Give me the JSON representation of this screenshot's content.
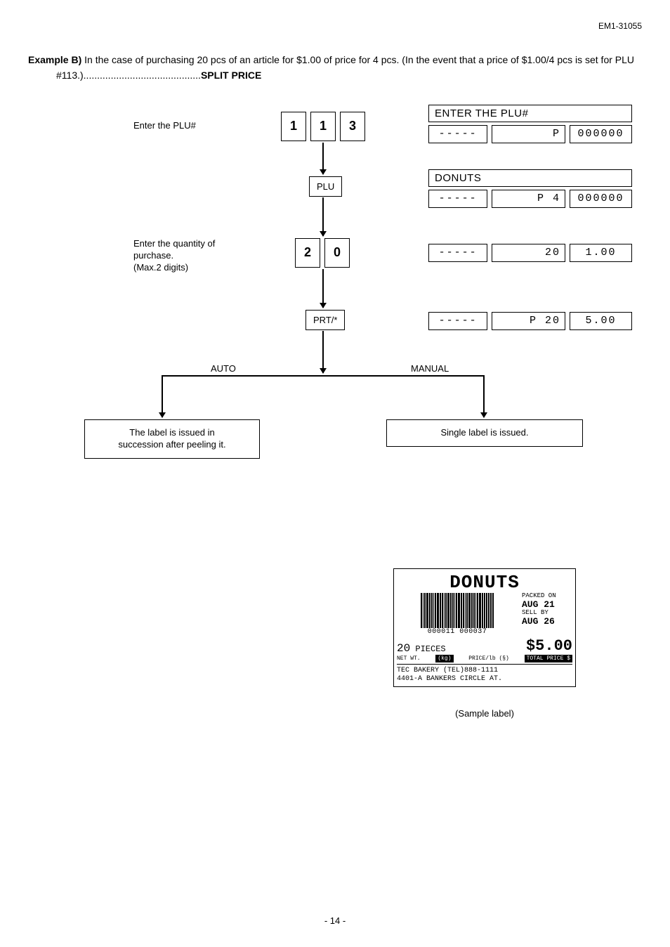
{
  "header": {
    "code": "EM1-31055"
  },
  "example": {
    "label": "Example B)",
    "text_1": " In the case of purchasing 20 pcs of an article for $1.00 of price for 4 pcs. (In the event that a price of $1.00/4 pcs is set for PLU #113.)",
    "dots": "...........................................",
    "suffix": "SPLIT PRICE"
  },
  "flow": {
    "instr1": "Enter the PLU#",
    "keys1": [
      "1",
      "1",
      "3"
    ],
    "plu": "PLU",
    "instr2_a": "Enter the quantity of",
    "instr2_b": "purchase.",
    "instr2_c": "(Max.2 digits)",
    "keys2": [
      "2",
      "0"
    ],
    "prt": "PRT/*",
    "auto": "AUTO",
    "manual": "MANUAL",
    "result_auto_a": "The label is issued in",
    "result_auto_b": "succession after peeling it.",
    "result_manual": "Single label is issued."
  },
  "display": {
    "d1_top": "ENTER THE PLU#",
    "d1_a": "-----",
    "d1_b": "P",
    "d1_c": "000000",
    "d2_top": "DONUTS",
    "d2_a": "-----",
    "d2_b": "P       4",
    "d2_c": "000000",
    "d3_a": "-----",
    "d3_b": "20",
    "d3_c": "1.00",
    "d4_a": "-----",
    "d4_b": "P      20",
    "d4_c": "5.00"
  },
  "label": {
    "title": "DONUTS",
    "barcode_num": "000011 000037",
    "packed_on_lbl": "PACKED ON",
    "packed_on": "AUG 21",
    "sell_by_lbl": "SELL BY",
    "sell_by": "AUG 26",
    "pieces_n": "20",
    "pieces_t": "PIECES",
    "total": "$5.00",
    "netwt": "NET WT.",
    "kg": "(kg)",
    "priceper": "PRICE/lb (§)",
    "totalprice": "TOTAL PRICE $",
    "addr1": "TEC BAKERY (TEL)888-1111",
    "addr2": "4401-A BANKERS CIRCLE AT.",
    "caption": "(Sample label)"
  },
  "page": "- 14 -"
}
